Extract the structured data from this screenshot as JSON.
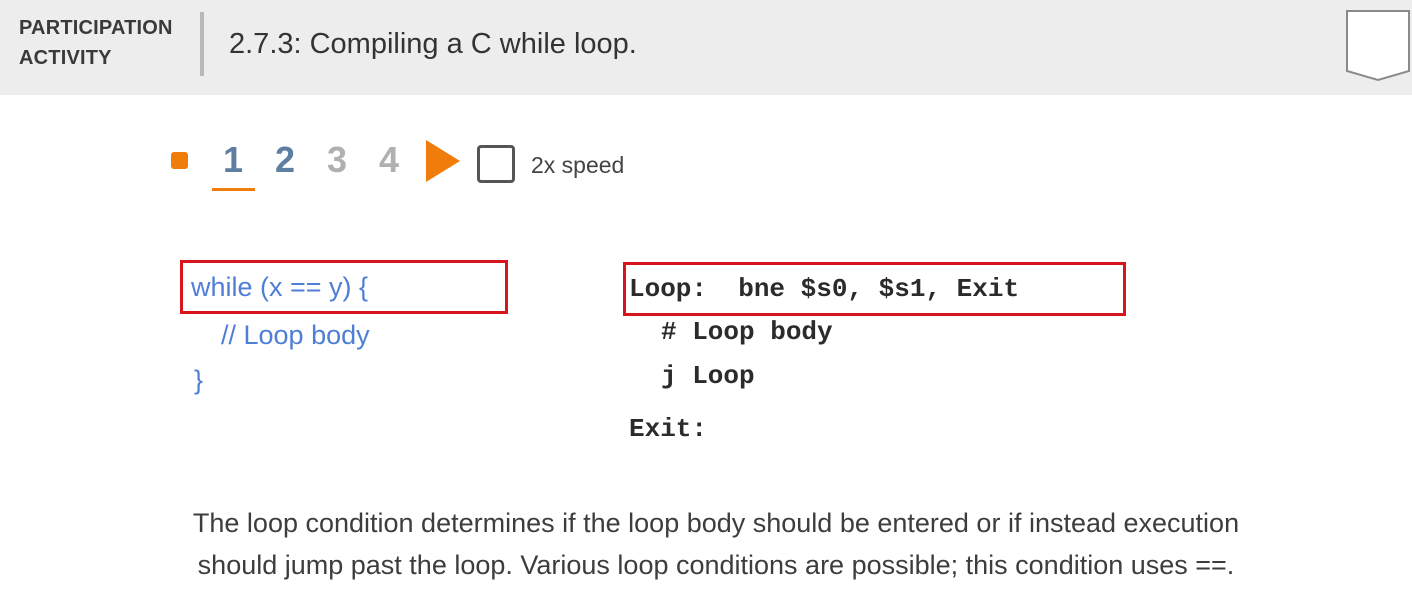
{
  "header": {
    "label_line1": "PARTICIPATION",
    "label_line2": "ACTIVITY",
    "title": "2.7.3: Compiling a C while loop."
  },
  "controls": {
    "steps": [
      "1",
      "2",
      "3",
      "4"
    ],
    "active_step": "1",
    "speed_label": "2x speed",
    "speed_checked": false
  },
  "c_code": {
    "line1": "while (x == y) {",
    "line2": "// Loop body",
    "line3": "}"
  },
  "asm_code": {
    "line1": "Loop:  bne $s0, $s1, Exit",
    "line2": "# Loop body",
    "line3": "j Loop",
    "line4": "Exit:"
  },
  "caption": {
    "line1": "The loop condition determines if the loop body should be entered or if instead execution",
    "line2": "should jump past the loop. Various loop conditions are possible; this condition uses ==."
  },
  "colors": {
    "accent_orange": "#f07c0c",
    "step_blue": "#5e7fa2",
    "c_code_blue": "#4f7ed6",
    "highlight_red": "#d8141c"
  },
  "icons": {
    "bookmark": "bookmark-icon",
    "play": "play-icon",
    "step_marker": "orange-square-icon"
  }
}
